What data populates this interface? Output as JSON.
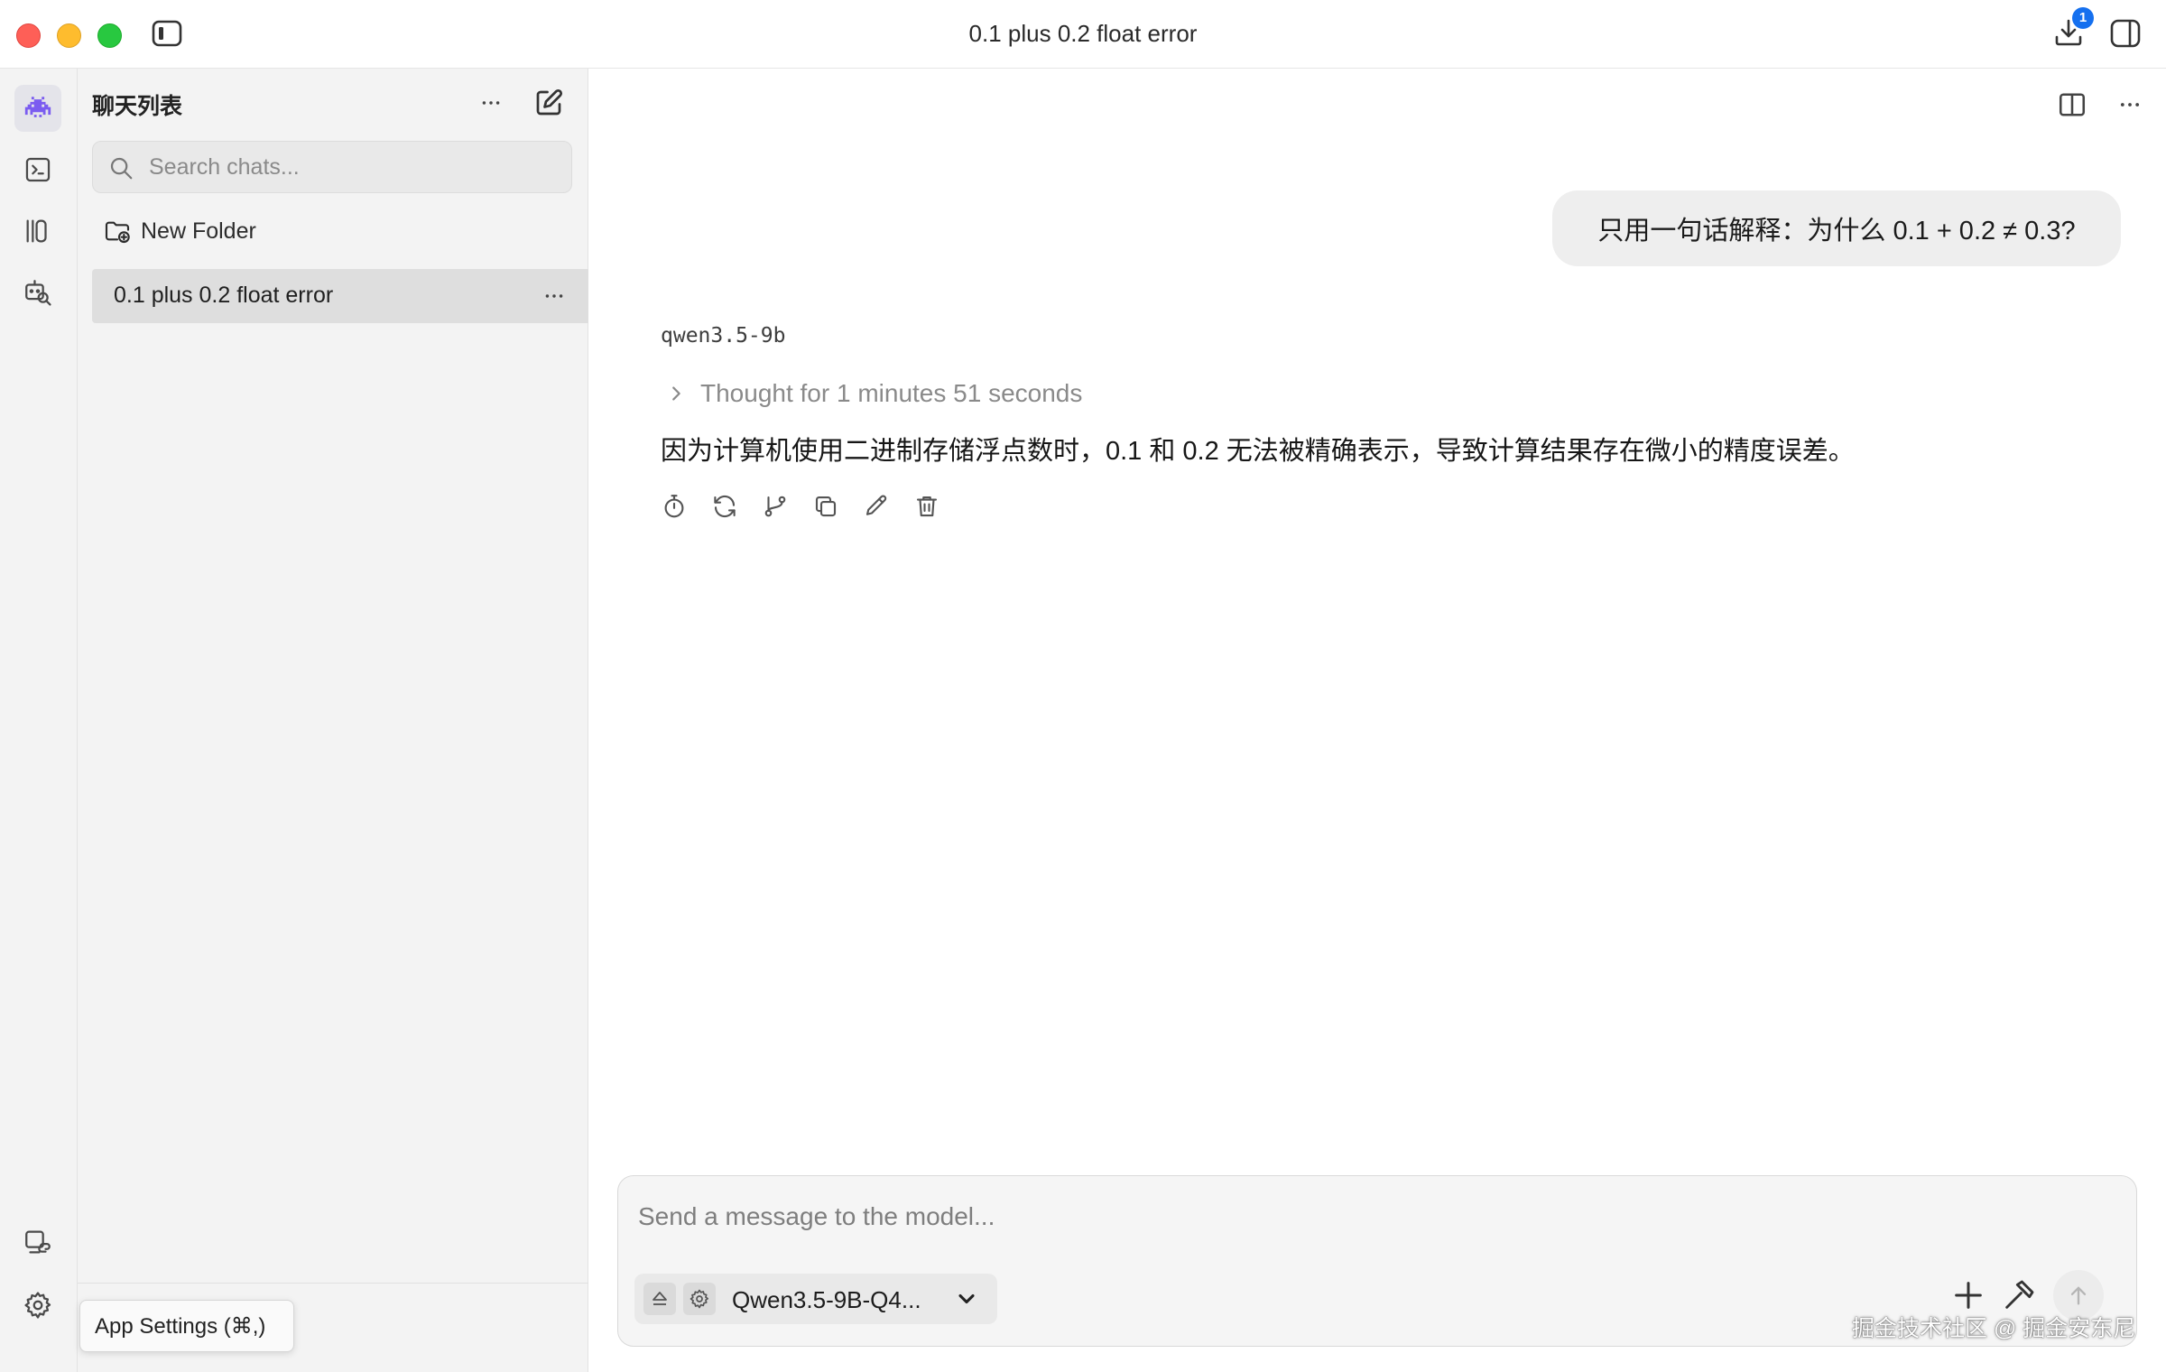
{
  "window": {
    "title": "0.1 plus 0.2 float error",
    "download_badge": "1"
  },
  "rail": {
    "items": [
      {
        "name": "chat",
        "icon": "alien-invader-icon",
        "active": true
      },
      {
        "name": "terminal",
        "icon": "terminal-icon"
      },
      {
        "name": "models",
        "icon": "library-icon"
      },
      {
        "name": "discover",
        "icon": "robot-search-icon"
      }
    ],
    "bottom": [
      {
        "name": "developer",
        "icon": "device-link-icon"
      },
      {
        "name": "settings",
        "icon": "gear-icon"
      }
    ]
  },
  "chat_panel": {
    "title": "聊天列表",
    "search_placeholder": "Search chats...",
    "new_folder_label": "New Folder",
    "chats": [
      {
        "title": "0.1 plus 0.2 float error",
        "selected": true
      }
    ]
  },
  "conversation": {
    "user_message": "只用一句话解释：为什么 0.1 + 0.2 ≠ 0.3?",
    "model_name": "qwen3.5-9b",
    "thought_label": "Thought for 1 minutes 51 seconds",
    "answer": "因为计算机使用二进制存储浮点数时，0.1 和 0.2 无法被精确表示，导致计算结果存在微小的精度误差。",
    "actions": [
      "timer-icon",
      "regenerate-icon",
      "branch-icon",
      "copy-icon",
      "edit-icon",
      "delete-icon"
    ]
  },
  "composer": {
    "placeholder": "Send a message to the model...",
    "model_label": "Qwen3.5-9B-Q4..."
  },
  "tooltip": {
    "text": "App Settings (⌘,)"
  },
  "watermark": "掘金技术社区 @ 掘金安东尼",
  "colors": {
    "accent": "#7b5cf0",
    "badge": "#1570ef",
    "sidebar_bg": "#f3f3f3",
    "selected_chat": "#dedede"
  }
}
